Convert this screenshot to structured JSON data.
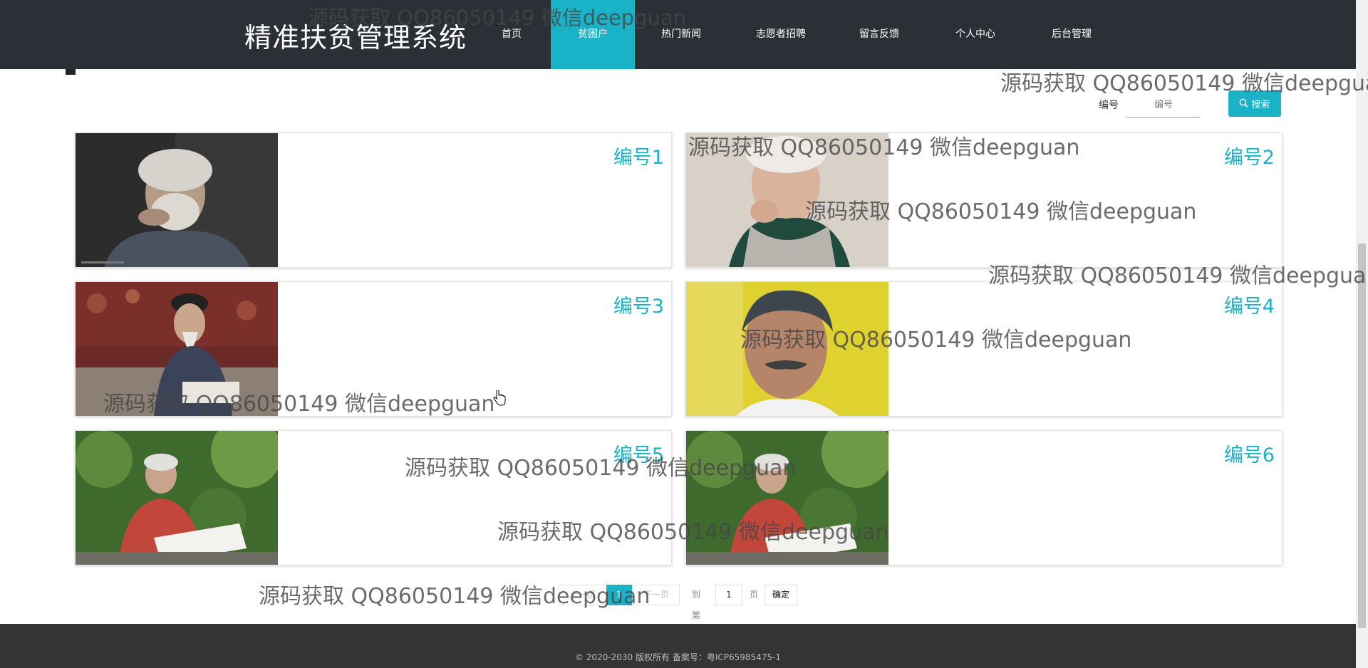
{
  "header": {
    "brand": "精准扶贫管理系统",
    "menu": [
      {
        "label": "首页"
      },
      {
        "label": "贫困户"
      },
      {
        "label": "热门新闻"
      },
      {
        "label": "志愿者招聘"
      },
      {
        "label": "留言反馈"
      },
      {
        "label": "个人中心"
      },
      {
        "label": "后台管理"
      }
    ],
    "active_menu": "贫困户"
  },
  "search": {
    "label": "编号",
    "placeholder": "编号",
    "button_label": "搜索"
  },
  "cards": [
    {
      "id_label": "编号1",
      "photo": "elderly-man-smoking"
    },
    {
      "id_label": "编号2",
      "photo": "elderly-woman-smiling"
    },
    {
      "id_label": "编号3",
      "photo": "elderly-man-writing"
    },
    {
      "id_label": "编号4",
      "photo": "elderly-man-mustache"
    },
    {
      "id_label": "编号5",
      "photo": "elderly-man-reading-newspaper"
    },
    {
      "id_label": "编号6",
      "photo": "elderly-man-reading-newspaper"
    }
  ],
  "pagination": {
    "prev_label": "上一页",
    "current_page": "1",
    "next_label": "下一页",
    "goto_prefix": "到第",
    "goto_value": "1",
    "goto_suffix": "页",
    "confirm_label": "确定"
  },
  "footer": {
    "copyright": "© 2020-2030 版权所有 备案号：粤ICP65985475-1"
  },
  "watermark": "源码获取 QQ86050149 微信deepguan",
  "colors": {
    "nav_bg": "#2b2f36",
    "accent": "#1ab2c6",
    "footer_bg": "#343434"
  }
}
